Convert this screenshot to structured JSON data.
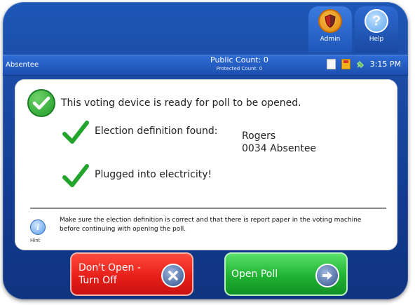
{
  "header": {
    "admin_label": "Admin",
    "help_label": "Help",
    "help_glyph": "?"
  },
  "status_bar": {
    "mode": "Absentee",
    "public_count": "Public Count: 0",
    "protected_count": "Protected Count: 0",
    "time": "3:15 PM"
  },
  "main": {
    "ready_message": "This voting device is ready for poll to be opened.",
    "election_definition_label": "Election definition found:",
    "election_name": "Rogers",
    "election_detail": "0034 Absentee",
    "electricity_label": "Plugged into electricity!",
    "hint_label": "Hint",
    "hint_text": "Make sure the election definition is correct and that there is report paper in the voting machine before continuing with opening the poll."
  },
  "buttons": {
    "dont_open_label": "Don't Open -\nTurn Off",
    "open_poll_label": "Open Poll"
  },
  "colors": {
    "device_blue": "#1a4aa3",
    "ok_green": "#1f9a28",
    "danger_red": "#e81f1a",
    "go_green": "#1fb332"
  },
  "icons": [
    "shield-icon",
    "help-icon",
    "document-icon",
    "floppy-icon",
    "plug-icon",
    "check-circle-icon",
    "check-icon",
    "info-icon",
    "x-icon",
    "arrow-right-icon"
  ]
}
